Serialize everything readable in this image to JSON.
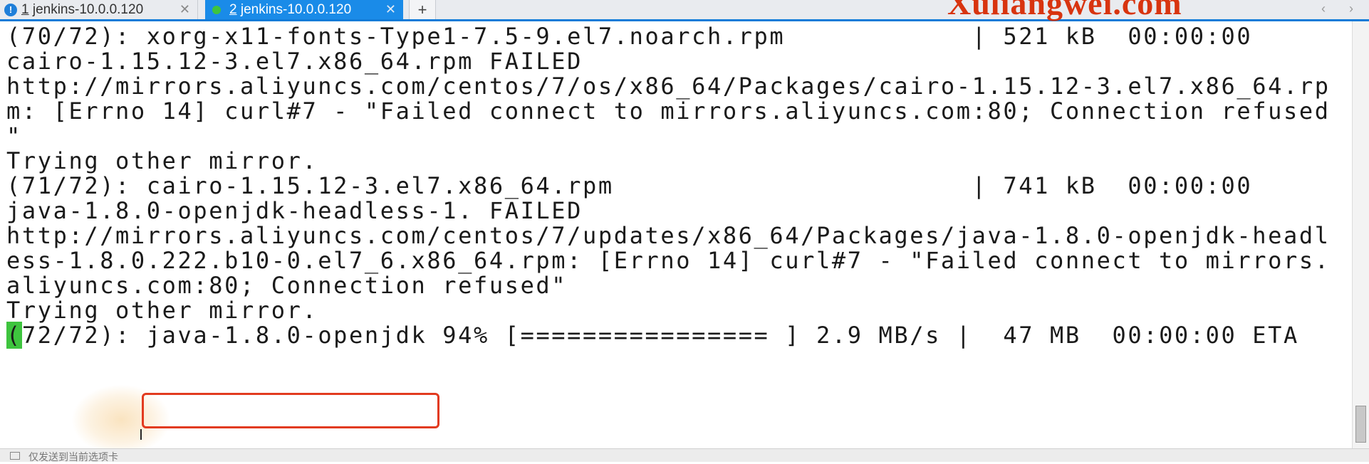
{
  "tabs": [
    {
      "number": "1",
      "title": " jenkins-10.0.0.120",
      "icon": "alert-icon",
      "close": "✕"
    },
    {
      "number": "2",
      "title": " jenkins-10.0.0.120",
      "icon": "connected-dot-icon",
      "close": "✕"
    }
  ],
  "add_tab": "+",
  "watermark": "Xuliangwei.com",
  "nav_arrows": "‹ ›",
  "terminal": {
    "lines": [
      "(70/72): xorg-x11-fonts-Type1-7.5-9.el7.noarch.rpm            | 521 kB  00:00:00",
      "cairo-1.15.12-3.el7.x86_64.rpm FAILED",
      "http://mirrors.aliyuncs.com/centos/7/os/x86_64/Packages/cairo-1.15.12-3.el7.x86_64.rp",
      "m: [Errno 14] curl#7 - \"Failed connect to mirrors.aliyuncs.com:80; Connection refused",
      "\"",
      "Trying other mirror.",
      "(71/72): cairo-1.15.12-3.el7.x86_64.rpm                       | 741 kB  00:00:00",
      "java-1.8.0-openjdk-headless-1. FAILED",
      "http://mirrors.aliyuncs.com/centos/7/updates/x86_64/Packages/java-1.8.0-openjdk-headl",
      "ess-1.8.0.222.b10-0.el7_6.x86_64.rpm: [Errno 14] curl#7 - \"Failed connect to mirrors.",
      "aliyuncs.com:80; Connection refused\"",
      "Trying other mirror."
    ],
    "progress_cursor_char": "(",
    "progress_line_rest": "72/72): java-1.8.0-openjdk 94% [================ ] 2.9 MB/s |  47 MB  00:00:00 ETA",
    "highlighted_text": "java-1.8.0-openjdk",
    "download_percent": 94
  },
  "status_bar": {
    "text": "仅发送到当前选项卡"
  },
  "colors": {
    "tab_active": "#1a8be8",
    "tab_underline": "#0f7bd8",
    "watermark": "#d8340f",
    "highlight_box": "#e23b1f",
    "cursor": "#3ec43e"
  }
}
